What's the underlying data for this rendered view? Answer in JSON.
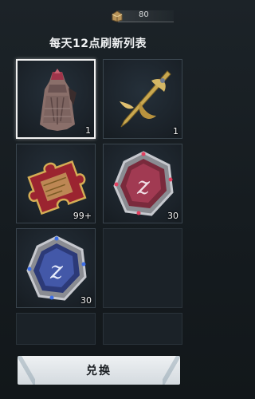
{
  "currency": {
    "amount": "80",
    "icon": "treasure-chest-icon"
  },
  "title": "每天12点刷新列表",
  "items": [
    {
      "name": "cloak",
      "icon": "cloak-icon",
      "count": "1",
      "selected": true
    },
    {
      "name": "golden-blade",
      "icon": "golden-blade-icon",
      "count": "1"
    },
    {
      "name": "puzzle-piece",
      "icon": "puzzle-piece-icon",
      "count": "99+"
    },
    {
      "name": "red-z-token",
      "icon": "red-z-token-icon",
      "count": "30"
    },
    {
      "name": "blue-z-token",
      "icon": "blue-z-token-icon",
      "count": "30"
    }
  ],
  "button": {
    "label": "兑换"
  }
}
